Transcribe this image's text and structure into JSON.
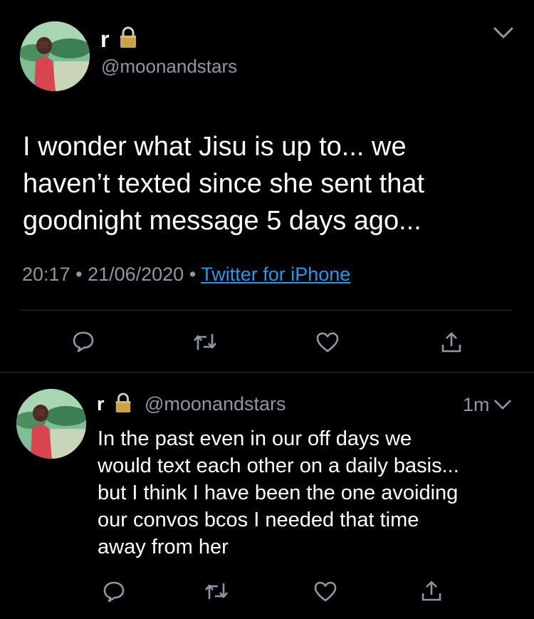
{
  "main_tweet": {
    "name": "r",
    "handle": "@moonandstars",
    "text_lines": [
      "I wonder what Jisu is up to... we",
      "haven’t texted since she sent that",
      "goodnight message 5 days ago..."
    ],
    "time": "20:17",
    "separator": "•",
    "date": "21/06/2020",
    "source": "Twitter for iPhone"
  },
  "reply_tweet": {
    "name": "r",
    "handle": "@moonandstars",
    "age": "1m",
    "text_lines": [
      "In the past even in our off days we",
      "would text each other on a daily basis...",
      "but I think I have been the one avoiding",
      "our convos bcos I needed that time",
      "away from her"
    ]
  },
  "icons": {
    "lock": "lock-icon",
    "chevron": "chevron-down-icon",
    "reply": "reply-icon",
    "retweet": "retweet-icon",
    "like": "heart-icon",
    "share": "share-icon"
  },
  "colors": {
    "background": "#000000",
    "text": "#ffffff",
    "muted": "#8b98a5",
    "link": "#1d9bf0",
    "divider": "#2f3336"
  }
}
